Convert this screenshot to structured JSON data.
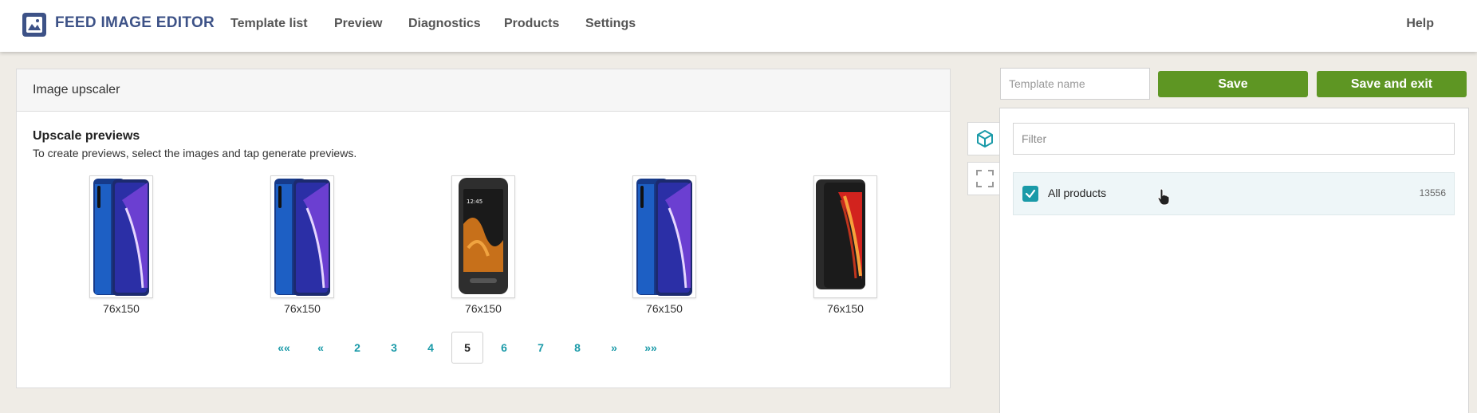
{
  "header": {
    "brand": "FEED IMAGE EDITOR",
    "nav": [
      "Template list",
      "Preview",
      "Diagnostics",
      "Products",
      "Settings"
    ],
    "help": "Help"
  },
  "card": {
    "title": "Image upscaler",
    "section_title": "Upscale previews",
    "section_desc": "To create previews, select the images and tap generate previews.",
    "thumbnails": [
      {
        "label": "76x150",
        "style": "blue"
      },
      {
        "label": "76x150",
        "style": "blue"
      },
      {
        "label": "76x150",
        "style": "rugged"
      },
      {
        "label": "76x150",
        "style": "blue"
      },
      {
        "label": "76x150",
        "style": "red"
      }
    ]
  },
  "pagination": [
    "««",
    "«",
    "2",
    "3",
    "4",
    "5",
    "6",
    "7",
    "8",
    "»",
    "»»"
  ],
  "pagination_active": "5",
  "template": {
    "name_placeholder": "Template name",
    "save_label": "Save",
    "save_exit_label": "Save and exit"
  },
  "products": {
    "filter_placeholder": "Filter",
    "all_label": "All products",
    "all_count": "13556",
    "all_checked": true
  },
  "colors": {
    "brand": "#3d5287",
    "accent": "#1a9aa8",
    "save": "#5e9623"
  }
}
